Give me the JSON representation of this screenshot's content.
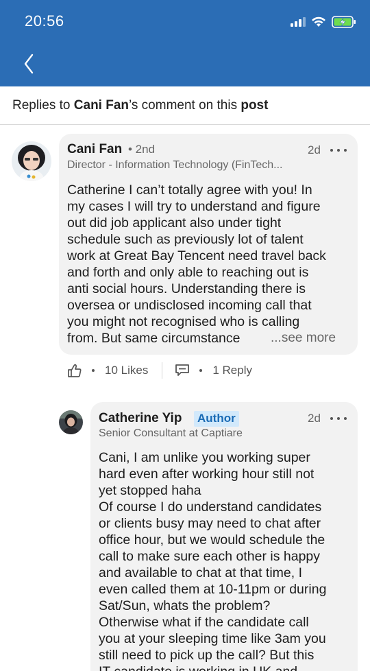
{
  "status_bar": {
    "time": "20:56",
    "icons": [
      "signal-icon",
      "wifi-icon",
      "battery-charging-icon"
    ]
  },
  "nav": {
    "back_icon": "chevron-left-icon"
  },
  "subheader": {
    "prefix": "Replies to ",
    "name": "Cani Fan",
    "middle": "’s comment on this ",
    "post_word": "post"
  },
  "comment": {
    "author": "Cani Fan",
    "degree": "• 2nd",
    "headline": "Director - Information Technology (FinTech...",
    "time_ago": "2d",
    "text": "Catherine I can’t totally agree with you! In\nmy cases I will try to understand and figure\nout did job applicant also under tight\nschedule such as previously lot of talent\nwork at Great Bay Tencent need travel back\nand forth and only able to reaching out is\nanti social hours. Understanding there is\noversea or undisclosed incoming call that\nyou might not recognised who is calling\nfrom. But same circumstance",
    "see_more": "...see more",
    "likes": "10 Likes",
    "replies": "1 Reply"
  },
  "reply": {
    "author": "Catherine Yip",
    "badge": "Author",
    "headline": "Senior Consultant at Captiare",
    "time_ago": "2d",
    "text": "Cani, I am unlike you working super\nhard even after working hour still not\nyet stopped haha\nOf course I do understand candidates\nor clients busy may need to chat after\noffice hour, but we would schedule the\ncall to make sure each other is happy\nand available to chat at that time, I\neven called them at 10-11pm or during\nSat/Sun, whats the problem?\nOtherwise what if the candidate call\nyou at your sleeping time like 3am you\nstill need to pick up the call? But this\nIT candidate is working in UK and"
  },
  "colors": {
    "header_blue": "#2b6db5",
    "bubble_gray": "#f2f2f2",
    "badge_bg": "#d2e9fb",
    "badge_text": "#1a6bb5",
    "battery_green": "#6fdc4e"
  }
}
